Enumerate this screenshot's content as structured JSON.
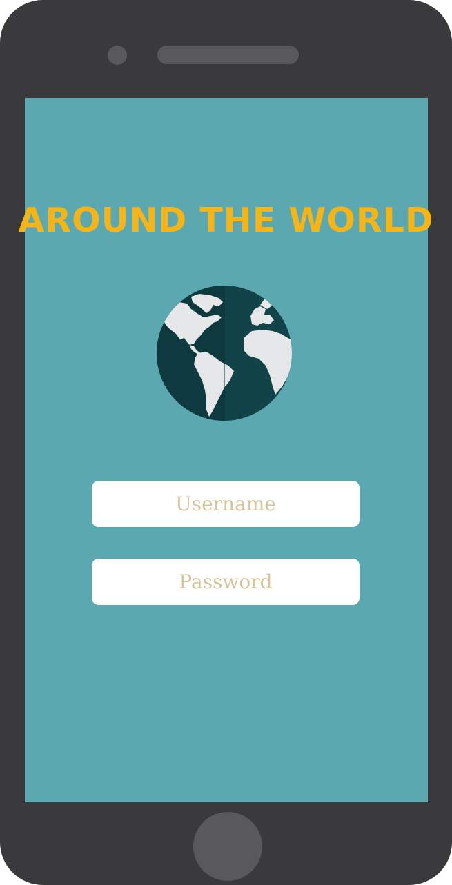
{
  "app": {
    "title": "AROUND THE WORLD"
  },
  "form": {
    "username_placeholder": "Username",
    "password_placeholder": "Password"
  },
  "icons": {
    "logo": "globe-icon",
    "camera": "camera-icon",
    "speaker": "speaker-grille",
    "home": "home-button"
  },
  "colors": {
    "phone_body": "#3a3a3c",
    "screen_background": "#5ca8b1",
    "title": "#f5b519",
    "globe_ocean": "#124349",
    "globe_land": "#e6e7e8",
    "input_background": "#ffffff",
    "placeholder_text": "#d9c39a"
  }
}
